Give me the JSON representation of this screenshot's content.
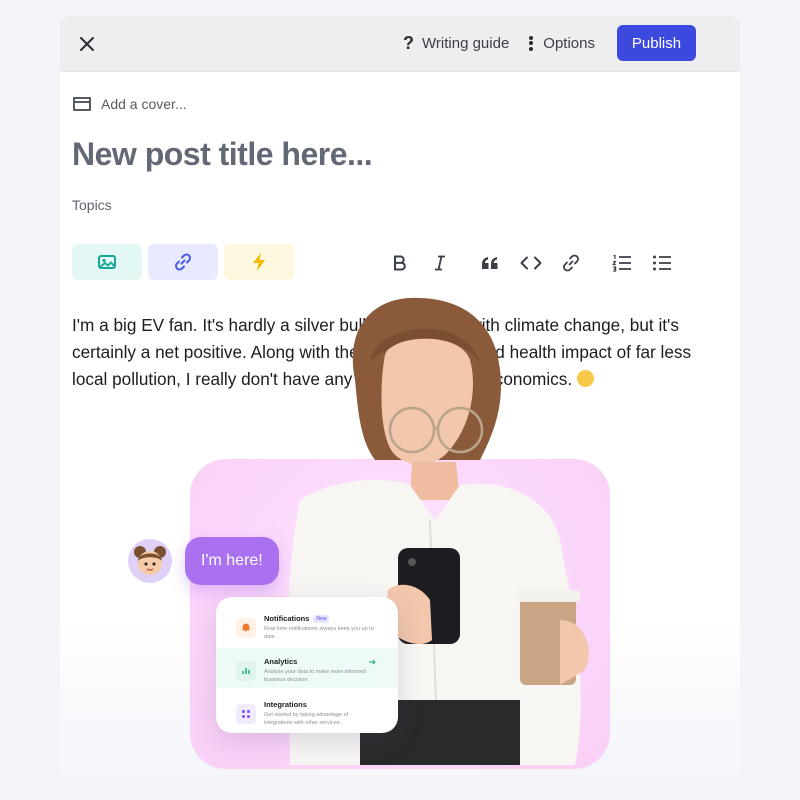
{
  "topbar": {
    "writing_guide_label": "Writing guide",
    "options_label": "Options",
    "publish_label": "Publish"
  },
  "cover": {
    "label": "Add a cover..."
  },
  "post": {
    "title_placeholder": "New post title here...",
    "topics_label": "Topics",
    "body_text": "I'm a big EV fan. It's hardly a silver bullet in the fight with climate change, but it's certainly a net positive. Along with the environmental and health impact of far less local pollution, I really don't have any gripes about the economics."
  },
  "toolbar": {
    "insert_buttons": [
      {
        "icon": "image-icon",
        "color": "#e3f8f5"
      },
      {
        "icon": "link-icon",
        "color": "#e8eaff"
      },
      {
        "icon": "lightning-icon",
        "color": "#fff8e1"
      }
    ],
    "format_buttons": [
      "bold-icon",
      "italic-icon",
      "quote-icon",
      "code-icon",
      "link-icon",
      "ordered-list-icon",
      "unordered-list-icon"
    ]
  },
  "overlay": {
    "bubble_text": "I'm here!",
    "card": [
      {
        "title": "Notifications",
        "badge": "New",
        "desc": "Real time notifications always keep you up to date.",
        "icon": "bell-icon"
      },
      {
        "title": "Analytics",
        "desc": "Analyze your data to make more informed business decision.",
        "icon": "chart-icon"
      },
      {
        "title": "Integrations",
        "desc": "Get started by taking advantage of integrations with other services.",
        "icon": "grid-icon"
      }
    ]
  },
  "colors": {
    "accent": "#3b49df",
    "bubble": "#a970f0",
    "pink_panel": "#fbd6fb"
  }
}
